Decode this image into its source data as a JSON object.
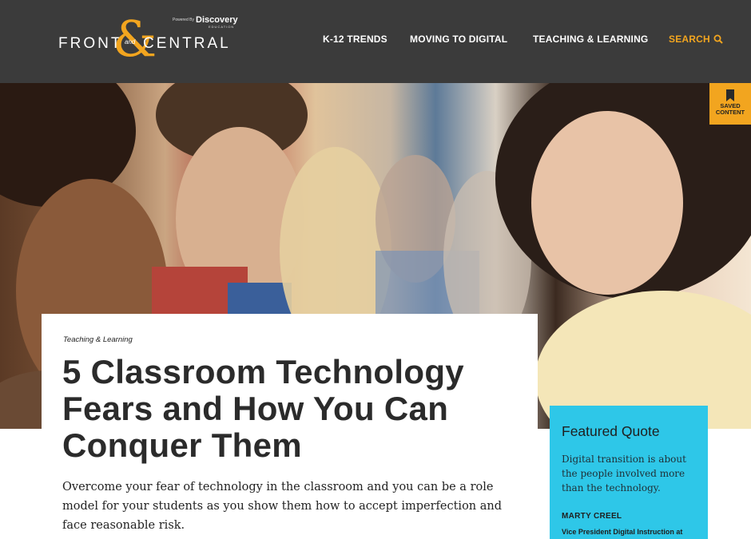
{
  "header": {
    "logo": {
      "front": "FRONT",
      "ampersand": "&",
      "and": "and",
      "central": "CENTRAL",
      "powered_by": "Powered By",
      "partner": "Discovery",
      "partner_sub": "EDUCATION"
    },
    "nav": [
      {
        "label": "K-12 TRENDS"
      },
      {
        "label": "MOVING TO DIGITAL"
      },
      {
        "label": "TEACHING & LEARNING"
      }
    ],
    "search": {
      "label": "SEARCH",
      "icon": "search-icon"
    }
  },
  "hero": {
    "image": "classroom-students-and-teacher-photo"
  },
  "saved_content": {
    "label_line1": "SAVED",
    "label_line2": "CONTENT",
    "icon": "bookmark-icon"
  },
  "article": {
    "category": "Teaching & Learning",
    "title": "5 Classroom Technology Fears and How You Can Conquer Them",
    "summary": "Overcome your fear of technology in the classroom and you can be a role model for your students as you show them how to accept imperfection and face reasonable risk."
  },
  "featured_quote": {
    "heading": "Featured Quote",
    "text": "Digital transition is about the people involved more than the technology.",
    "author": "MARTY CREEL",
    "role": "Vice President Digital Instruction at"
  },
  "colors": {
    "header_bg": "#3b3b3b",
    "accent": "#f2a51f",
    "quote_bg": "#2ec7e8",
    "text_dark": "#2b2b2b"
  }
}
